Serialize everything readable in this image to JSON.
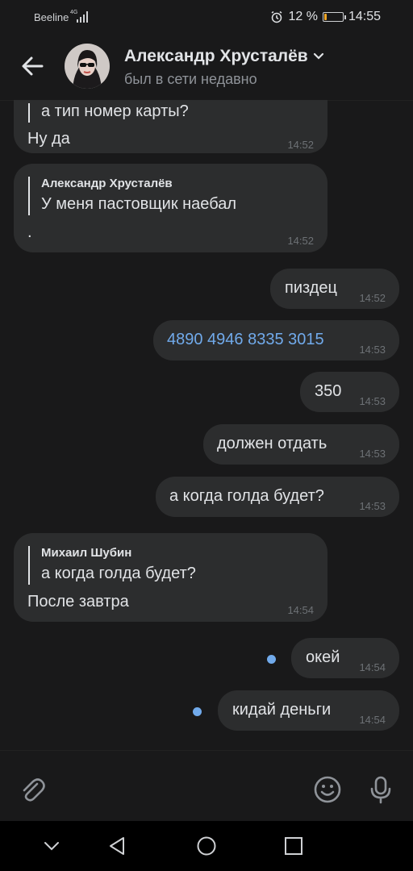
{
  "status_bar": {
    "carrier": "Beeline",
    "network": "4G",
    "battery_percent": "12 %",
    "battery_level": 0.12,
    "time": "14:55"
  },
  "header": {
    "peer_name": "Александр Хрусталёв",
    "peer_status": "был в сети недавно"
  },
  "messages": [
    {
      "side": "in",
      "reply_text": "а тип номер карты?",
      "text": "Ну да",
      "time": "14:52"
    },
    {
      "side": "in",
      "reply_author": "Александр Хрусталёв",
      "reply_text": "У меня пастовщик наебал",
      "text": ".",
      "time": "14:52"
    },
    {
      "side": "out",
      "text": "пиздец",
      "time": "14:52"
    },
    {
      "side": "out",
      "text": "4890 4946 8335 3015",
      "time": "14:53"
    },
    {
      "side": "out",
      "text": "350",
      "time": "14:53"
    },
    {
      "side": "out",
      "text": "должен отдать",
      "time": "14:53"
    },
    {
      "side": "out",
      "text": "а когда голда будет?",
      "time": "14:53"
    },
    {
      "side": "in",
      "reply_author": "Михаил Шубин",
      "reply_text": "а когда голда будет?",
      "text": "После завтра",
      "time": "14:54"
    },
    {
      "side": "out",
      "text": "окей",
      "time": "14:54",
      "unread": true
    },
    {
      "side": "out",
      "text": "кидай деньги",
      "time": "14:54",
      "unread": true
    }
  ],
  "colors": {
    "background": "#19191a",
    "bubble": "#2c2d2e",
    "accent": "#71aaeb",
    "battery": "#f5a623"
  },
  "icons": {
    "composer": [
      "paperclip-icon",
      "emoji-icon",
      "microphone-icon"
    ],
    "navigation": [
      "nav-down-icon",
      "nav-back-icon",
      "nav-home-icon",
      "nav-recents-icon"
    ]
  }
}
